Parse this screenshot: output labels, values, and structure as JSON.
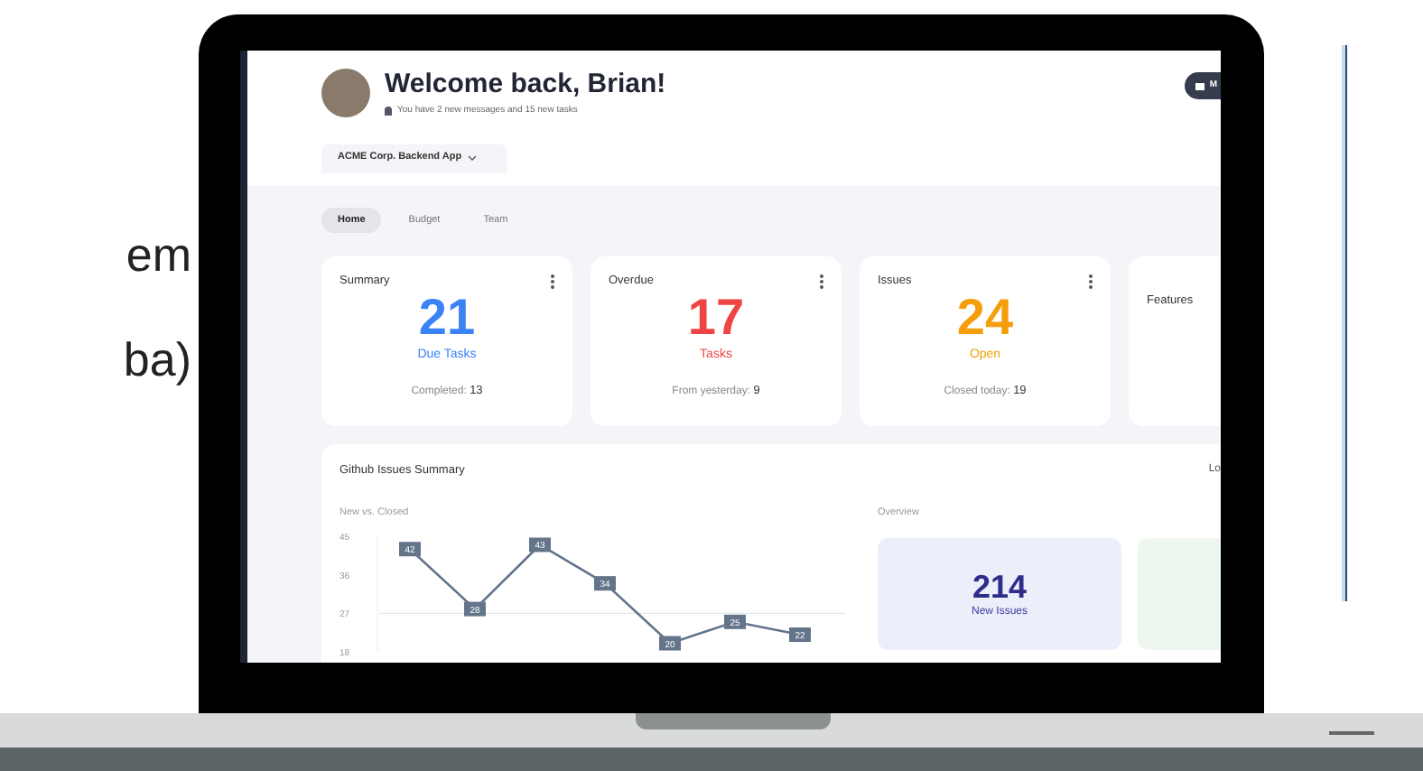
{
  "slide_text": [
    "em",
    "ba)"
  ],
  "header": {
    "title": "Welcome back, Brian!",
    "subtitle": "You have 2 new messages and 15 new tasks",
    "button": "M"
  },
  "project_dropdown": {
    "label": "ACME Corp. Backend App"
  },
  "tabs": [
    {
      "label": "Home",
      "selected": true
    },
    {
      "label": "Budget",
      "selected": false
    },
    {
      "label": "Team",
      "selected": false
    }
  ],
  "cards": [
    {
      "title": "Summary",
      "value": "21",
      "caption": "Due Tasks",
      "footer_label": "Completed:",
      "footer_value": "13",
      "color": "#3b82f6"
    },
    {
      "title": "Overdue",
      "value": "17",
      "caption": "Tasks",
      "footer_label": "From yesterday:",
      "footer_value": "9",
      "color": "#ef4444"
    },
    {
      "title": "Issues",
      "value": "24",
      "caption": "Open",
      "footer_label": "Closed today:",
      "footer_value": "19",
      "color": "#f59e0b"
    },
    {
      "title": "Features"
    }
  ],
  "issues_panel": {
    "title": "Github Issues Summary",
    "right_label": "Lo",
    "chart_title": "New vs. Closed",
    "overview_title": "Overview",
    "chart_data": {
      "type": "line",
      "ylim": [
        18,
        45
      ],
      "yticks": [
        45,
        36,
        27,
        18
      ],
      "data_labels": true,
      "series": [
        {
          "color": "#64748b",
          "marker": "square",
          "values": [
            42,
            28,
            43,
            34,
            20,
            25,
            22
          ]
        }
      ]
    },
    "overview": [
      {
        "value": "214",
        "caption": "New Issues",
        "kind": "new"
      },
      {
        "kind": "closed"
      }
    ]
  }
}
